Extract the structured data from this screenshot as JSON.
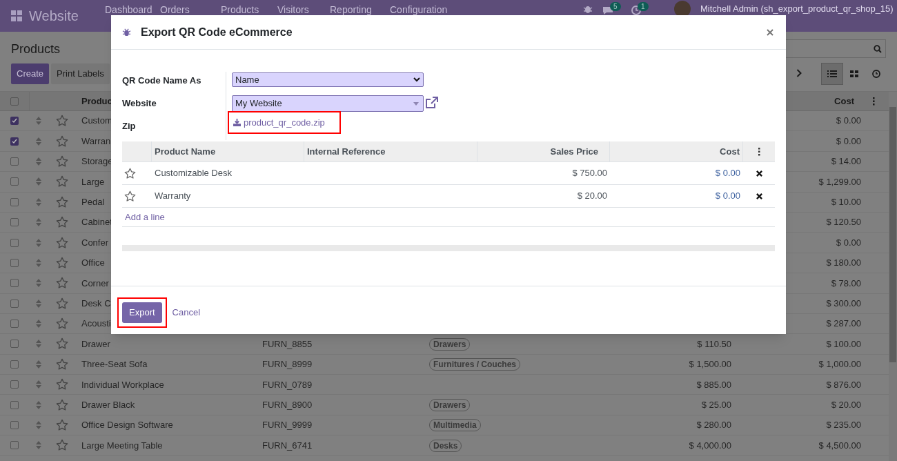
{
  "navbar": {
    "app_name": "Website",
    "menus": [
      "Dashboard",
      "Orders",
      "Products",
      "Visitors",
      "Reporting",
      "Configuration"
    ],
    "chat_count": "5",
    "activity_count": "1",
    "user": "Mitchell Admin (sh_export_product_qr_shop_15)"
  },
  "control_panel": {
    "title": "Products",
    "buttons": [
      {
        "label": "Create",
        "kind": "primary"
      },
      {
        "label": "Print Labels",
        "kind": "secondary"
      }
    ],
    "views": [
      {
        "kind": "list",
        "selected": true
      },
      {
        "kind": "kanban",
        "selected": false
      },
      {
        "kind": "activity",
        "selected": false
      }
    ]
  },
  "list": {
    "all_selected": false,
    "columns": [
      "Produc",
      "Cost"
    ],
    "rows": [
      {
        "selected": true,
        "name": "Custom",
        "cost": "$ 0.00"
      },
      {
        "selected": true,
        "name": "Warran",
        "cost": "$ 0.00"
      },
      {
        "selected": false,
        "name": "Storage",
        "cost": "$ 14.00"
      },
      {
        "selected": false,
        "name": "Large",
        "cost": "$ 1,299.00"
      },
      {
        "selected": false,
        "name": "Pedal",
        "cost": "$ 10.00"
      },
      {
        "selected": false,
        "name": "Cabinet",
        "cost": "$ 120.50"
      },
      {
        "selected": false,
        "name": "Confer",
        "cost": "$ 0.00"
      },
      {
        "selected": false,
        "name": "Office",
        "cost": "$ 180.00"
      },
      {
        "selected": false,
        "name": "Corner",
        "cost": "$ 78.00"
      },
      {
        "selected": false,
        "name": "Desk C",
        "cost": "$ 300.00"
      },
      {
        "selected": false,
        "name": "Acousti",
        "cost": "$ 287.00"
      },
      {
        "selected": false,
        "name": "Drawer",
        "reference": "FURN_8855",
        "tag": "Drawers",
        "sales_price": "$ 110.50",
        "cost": "$ 100.00"
      },
      {
        "selected": false,
        "name": "Three-Seat Sofa",
        "reference": "FURN_8999",
        "tag": "Furnitures / Couches",
        "sales_price": "$ 1,500.00",
        "cost": "$ 1,000.00"
      },
      {
        "selected": false,
        "name": "Individual Workplace",
        "reference": "FURN_0789",
        "sales_price": "$ 885.00",
        "cost": "$ 876.00"
      },
      {
        "selected": false,
        "name": "Drawer Black",
        "reference": "FURN_8900",
        "tag": "Drawers",
        "sales_price": "$ 25.00",
        "cost": "$ 20.00"
      },
      {
        "selected": false,
        "name": "Office Design Software",
        "reference": "FURN_9999",
        "tag": "Multimedia",
        "sales_price": "$ 280.00",
        "cost": "$ 235.00"
      },
      {
        "selected": false,
        "name": "Large Meeting Table",
        "reference": "FURN_6741",
        "tag": "Desks",
        "sales_price": "$ 4,000.00",
        "cost": "$ 4,500.00"
      }
    ]
  },
  "dialog": {
    "title": "Export QR Code eCommerce",
    "fields": [
      {
        "label": "QR Code Name As",
        "kind": "select",
        "value": "Name",
        "highlighted": false
      },
      {
        "label": "Website",
        "kind": "many2one",
        "value": "My Website",
        "highlighted": false
      },
      {
        "label": "Zip",
        "kind": "download",
        "value": "product_qr_code.zip",
        "highlighted": true
      }
    ],
    "lines": {
      "columns": [
        "Product Name",
        "Internal Reference",
        "Sales Price",
        "Cost"
      ],
      "rows": [
        {
          "name": "Customizable Desk",
          "sales_price": "$ 750.00",
          "cost": "$ 0.00"
        },
        {
          "name": "Warranty",
          "sales_price": "$ 20.00",
          "cost": "$ 0.00"
        }
      ],
      "add_line": "Add a line"
    },
    "buttons": [
      {
        "label": "Export",
        "kind": "primary",
        "highlighted": true
      },
      {
        "label": "Cancel",
        "kind": "link",
        "highlighted": false
      }
    ]
  }
}
